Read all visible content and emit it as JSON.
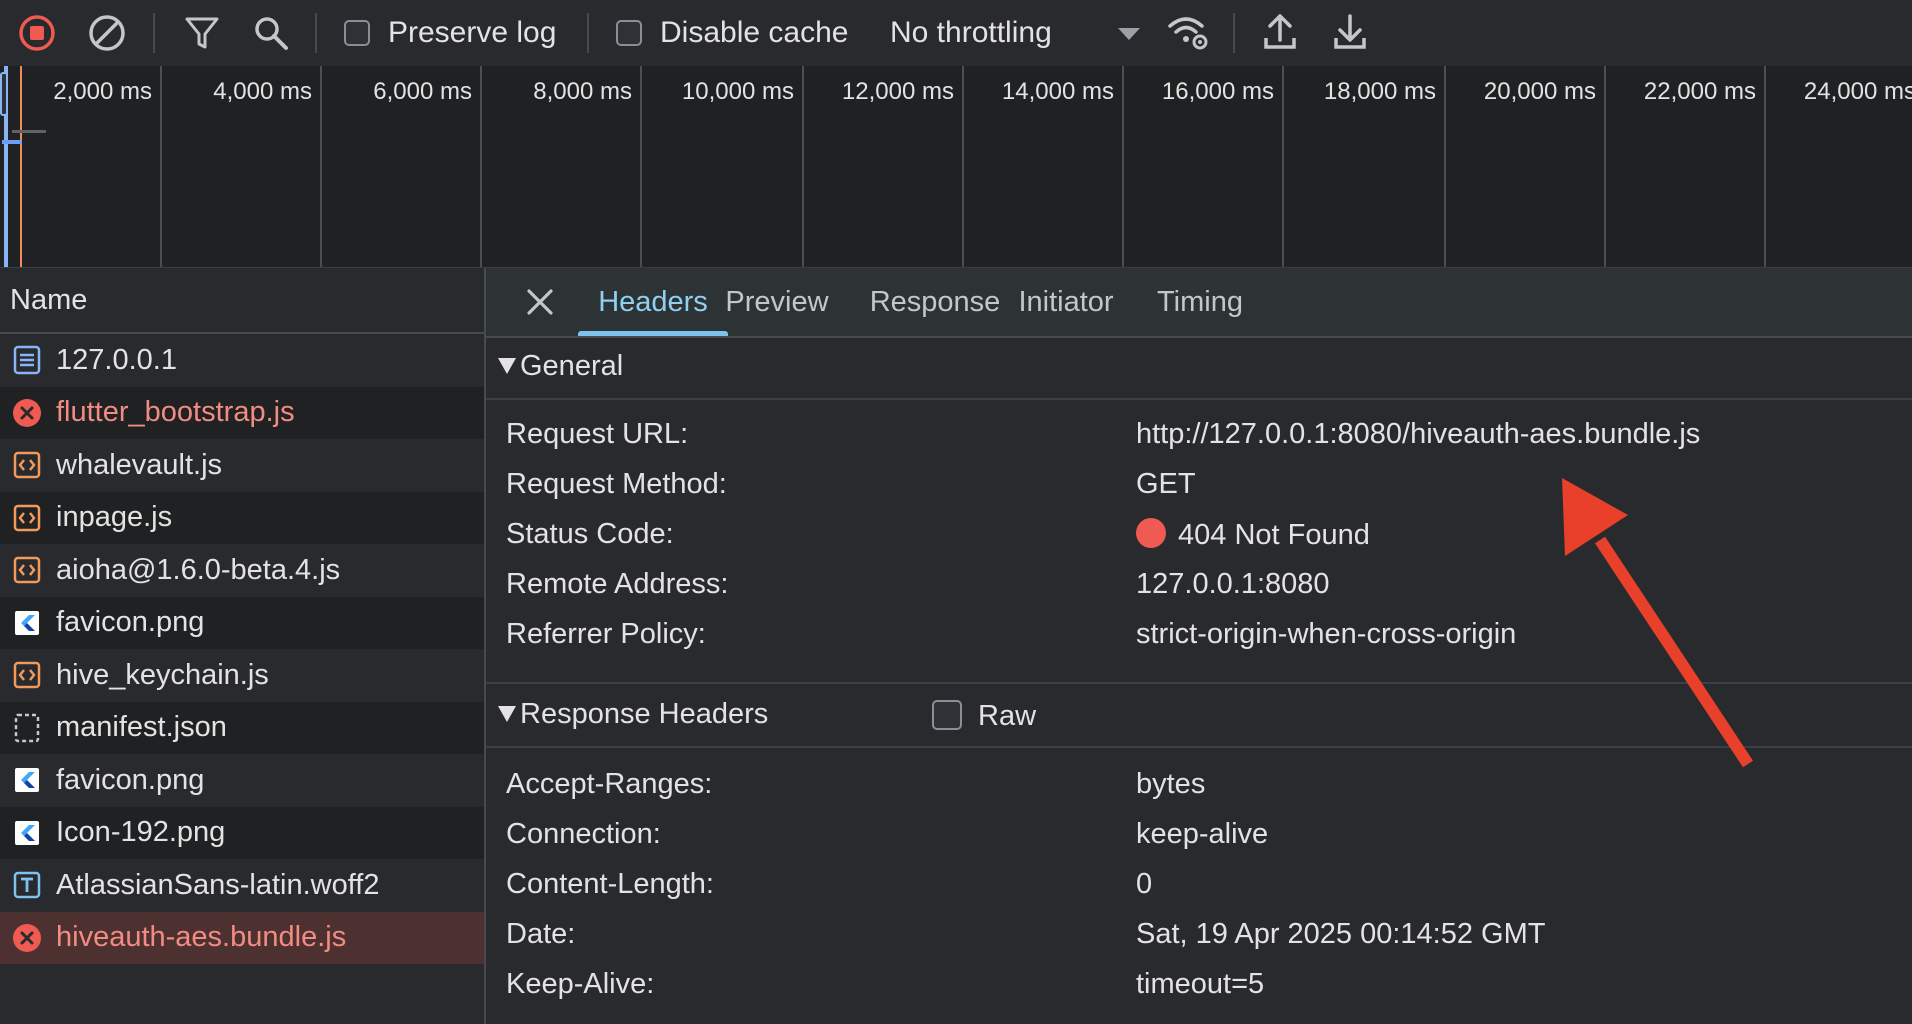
{
  "toolbar": {
    "preserve_log": "Preserve log",
    "disable_cache": "Disable cache",
    "throttling": "No throttling"
  },
  "overview": {
    "ticks": [
      "2,000 ms",
      "4,000 ms",
      "6,000 ms",
      "8,000 ms",
      "10,000 ms",
      "12,000 ms",
      "14,000 ms",
      "16,000 ms",
      "18,000 ms",
      "20,000 ms",
      "22,000 ms",
      "24,000 ms"
    ]
  },
  "request_list": {
    "header": "Name",
    "items": [
      {
        "label": "127.0.0.1",
        "type": "document",
        "error": false
      },
      {
        "label": "flutter_bootstrap.js",
        "type": "error",
        "error": true
      },
      {
        "label": "whalevault.js",
        "type": "script",
        "error": false
      },
      {
        "label": "inpage.js",
        "type": "script",
        "error": false
      },
      {
        "label": "aioha@1.6.0-beta.4.js",
        "type": "script",
        "error": false
      },
      {
        "label": "favicon.png",
        "type": "flutter-image",
        "error": false
      },
      {
        "label": "hive_keychain.js",
        "type": "script",
        "error": false
      },
      {
        "label": "manifest.json",
        "type": "json",
        "error": false
      },
      {
        "label": "favicon.png",
        "type": "flutter-image",
        "error": false
      },
      {
        "label": "Icon-192.png",
        "type": "flutter-image",
        "error": false
      },
      {
        "label": "AtlassianSans-latin.woff2",
        "type": "font",
        "error": false
      },
      {
        "label": "hiveauth-aes.bundle.js",
        "type": "error",
        "error": true,
        "selected": true
      }
    ]
  },
  "detail": {
    "tabs": [
      "Headers",
      "Preview",
      "Response",
      "Initiator",
      "Timing"
    ],
    "active_tab": "Headers",
    "general": {
      "title": "General",
      "rows": [
        {
          "key": "Request URL:",
          "value": "http://127.0.0.1:8080/hiveauth-aes.bundle.js"
        },
        {
          "key": "Request Method:",
          "value": "GET"
        },
        {
          "key": "Status Code:",
          "value": "404 Not Found"
        },
        {
          "key": "Remote Address:",
          "value": "127.0.0.1:8080"
        },
        {
          "key": "Referrer Policy:",
          "value": "strict-origin-when-cross-origin"
        }
      ]
    },
    "response_headers": {
      "title": "Response Headers",
      "raw_label": "Raw",
      "rows": [
        {
          "key": "Accept-Ranges:",
          "value": "bytes"
        },
        {
          "key": "Connection:",
          "value": "keep-alive"
        },
        {
          "key": "Content-Length:",
          "value": "0"
        },
        {
          "key": "Date:",
          "value": "Sat, 19 Apr 2025 00:14:52 GMT"
        },
        {
          "key": "Keep-Alive:",
          "value": "timeout=5"
        }
      ]
    }
  },
  "colors": {
    "background": "#282a2d",
    "error_text": "#f28b82",
    "selected_row": "#4d3131",
    "active_tab": "#8fd0f1",
    "annotation_arrow": "#e8402a"
  },
  "icons": [
    "stop-recording-icon",
    "clear-icon",
    "filter-icon",
    "search-icon",
    "network-conditions-icon",
    "upload-icon",
    "download-icon",
    "close-icon",
    "annotation-arrow"
  ]
}
